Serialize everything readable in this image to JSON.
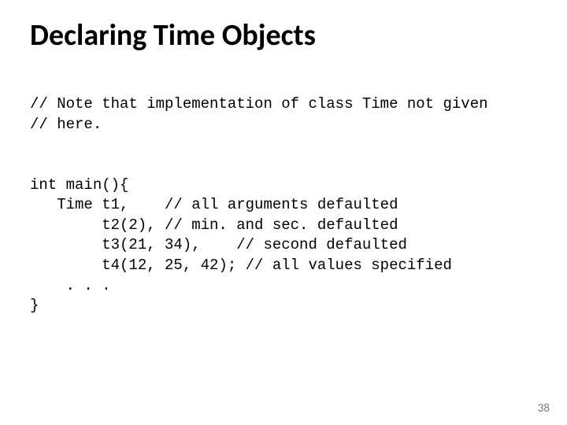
{
  "title": "Declaring Time Objects",
  "code": "// Note that implementation of class Time not given\n// here.\n\n\nint main(){\n   Time t1,    // all arguments defaulted\n        t2(2), // min. and sec. defaulted\n        t3(21, 34),    // second defaulted\n        t4(12, 25, 42); // all values specified\n    . . .\n}",
  "page_number": "38"
}
